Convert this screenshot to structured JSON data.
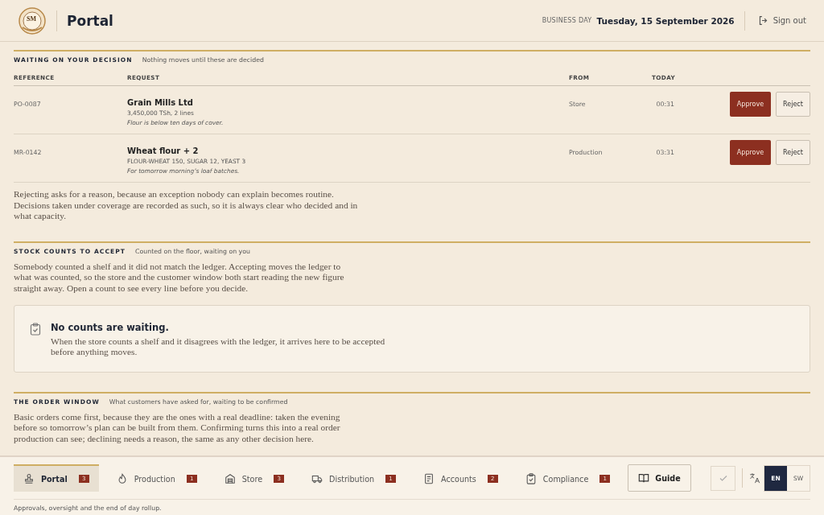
{
  "header": {
    "logo_monogram": "SM",
    "title": "Portal",
    "business_day_label": "BUSINESS DAY",
    "business_day": "Tuesday, 15 September 2026",
    "sign_out": "Sign out"
  },
  "decisions": {
    "title": "WAITING ON YOUR DECISION",
    "subtitle": "Nothing moves until these are decided",
    "columns": [
      "REFERENCE",
      "REQUEST",
      "FROM",
      "TODAY"
    ],
    "rows": [
      {
        "reference": "PO-0087",
        "request": "Grain Mills Ltd",
        "detail": "3,450,000 TSh, 2 lines",
        "note": "Flour is below ten days of cover.",
        "from": "Store",
        "today": "00:31",
        "approve": "Approve",
        "reject": "Reject"
      },
      {
        "reference": "MR-0142",
        "request": "Wheat flour + 2",
        "detail": "FLOUR-WHEAT 150, SUGAR 12, YEAST 3",
        "note": "For tomorrow morning’s loaf batches.",
        "from": "Production",
        "today": "03:31",
        "approve": "Approve",
        "reject": "Reject"
      }
    ],
    "footnote": "Rejecting asks for a reason, because an exception nobody can explain becomes routine. Decisions taken under coverage are recorded as such, so it is always clear who decided and in what capacity."
  },
  "stock_counts": {
    "title": "STOCK COUNTS TO ACCEPT",
    "subtitle": "Counted on the floor, waiting on you",
    "text": "Somebody counted a shelf and it did not match the ledger. Accepting moves the ledger to what was counted, so the store and the customer window both start reading the new figure straight away. Open a count to see every line before you decide.",
    "empty_title": "No counts are waiting.",
    "empty_text": "When the store counts a shelf and it disagrees with the ledger, it arrives here to be accepted before anything moves."
  },
  "order_window": {
    "title": "THE ORDER WINDOW",
    "subtitle": "What customers have asked for, waiting to be confirmed",
    "text": "Basic orders come first, because they are the ones with a real deadline: taken the evening before so tomorrow’s plan can be built from them. Confirming turns this into a real order production can see; declining needs a reason, the same as any other decision here."
  },
  "nav": {
    "tabs": [
      {
        "label": "Portal",
        "count": "3",
        "selected": true
      },
      {
        "label": "Production",
        "count": "1",
        "selected": false
      },
      {
        "label": "Store",
        "count": "3",
        "selected": false
      },
      {
        "label": "Distribution",
        "count": "1",
        "selected": false
      },
      {
        "label": "Accounts",
        "count": "2",
        "selected": false
      },
      {
        "label": "Compliance",
        "count": "1",
        "selected": false
      }
    ],
    "guide": "Guide",
    "languages": [
      {
        "label": "EN",
        "selected": true
      },
      {
        "label": "SW",
        "selected": false
      }
    ],
    "caption": "Approvals, oversight and the end of day rollup."
  }
}
